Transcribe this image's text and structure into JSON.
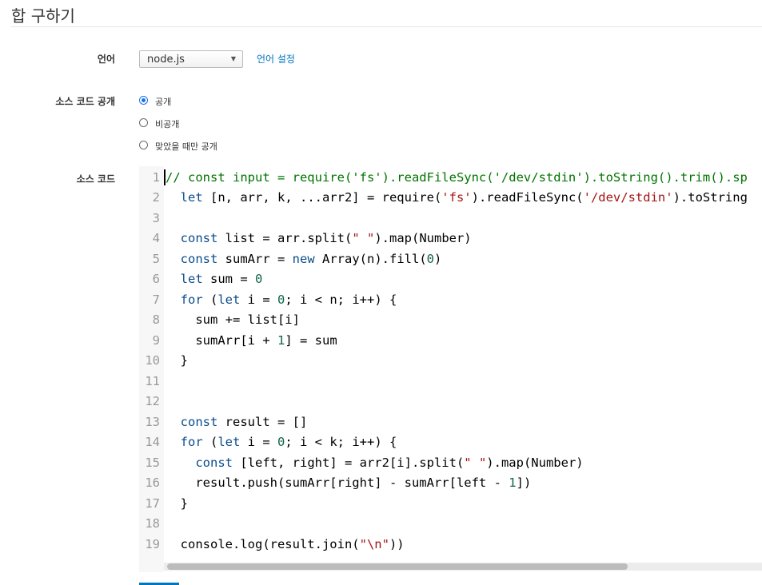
{
  "page": {
    "title": "합 구하기"
  },
  "form": {
    "language": {
      "label": "언어",
      "selected": "node.js",
      "settings_link": "언어 설정"
    },
    "visibility": {
      "label": "소스 코드 공개",
      "options": [
        {
          "label": "공개",
          "checked": true
        },
        {
          "label": "비공개",
          "checked": false
        },
        {
          "label": "맞았을 때만 공개",
          "checked": false
        }
      ]
    },
    "source": {
      "label": "소스 코드"
    }
  },
  "editor": {
    "line_numbers": [
      "1",
      "2",
      "3",
      "4",
      "5",
      "6",
      "7",
      "8",
      "9",
      "10",
      "11",
      "12",
      "13",
      "14",
      "15",
      "16",
      "17",
      "18",
      "19"
    ],
    "lines": [
      "// const input = require('fs').readFileSync('/dev/stdin').toString().trim().sp",
      "  let [n, arr, k, ...arr2] = require('fs').readFileSync('/dev/stdin').toString",
      "",
      "  const list = arr.split(\" \").map(Number)",
      "  const sumArr = new Array(n).fill(0)",
      "  let sum = 0",
      "  for (let i = 0; i < n; i++) {",
      "    sum += list[i]",
      "    sumArr[i + 1] = sum",
      "  }",
      "",
      "",
      "  const result = []",
      "  for (let i = 0; i < k; i++) {",
      "    const [left, right] = arr2[i].split(\" \").map(Number)",
      "    result.push(sumArr[right] - sumArr[left - 1])",
      "  }",
      "",
      "  console.log(result.join(\"\\n\"))"
    ]
  },
  "colors": {
    "accent": "#0076c0",
    "radio": "#1a73e8"
  }
}
